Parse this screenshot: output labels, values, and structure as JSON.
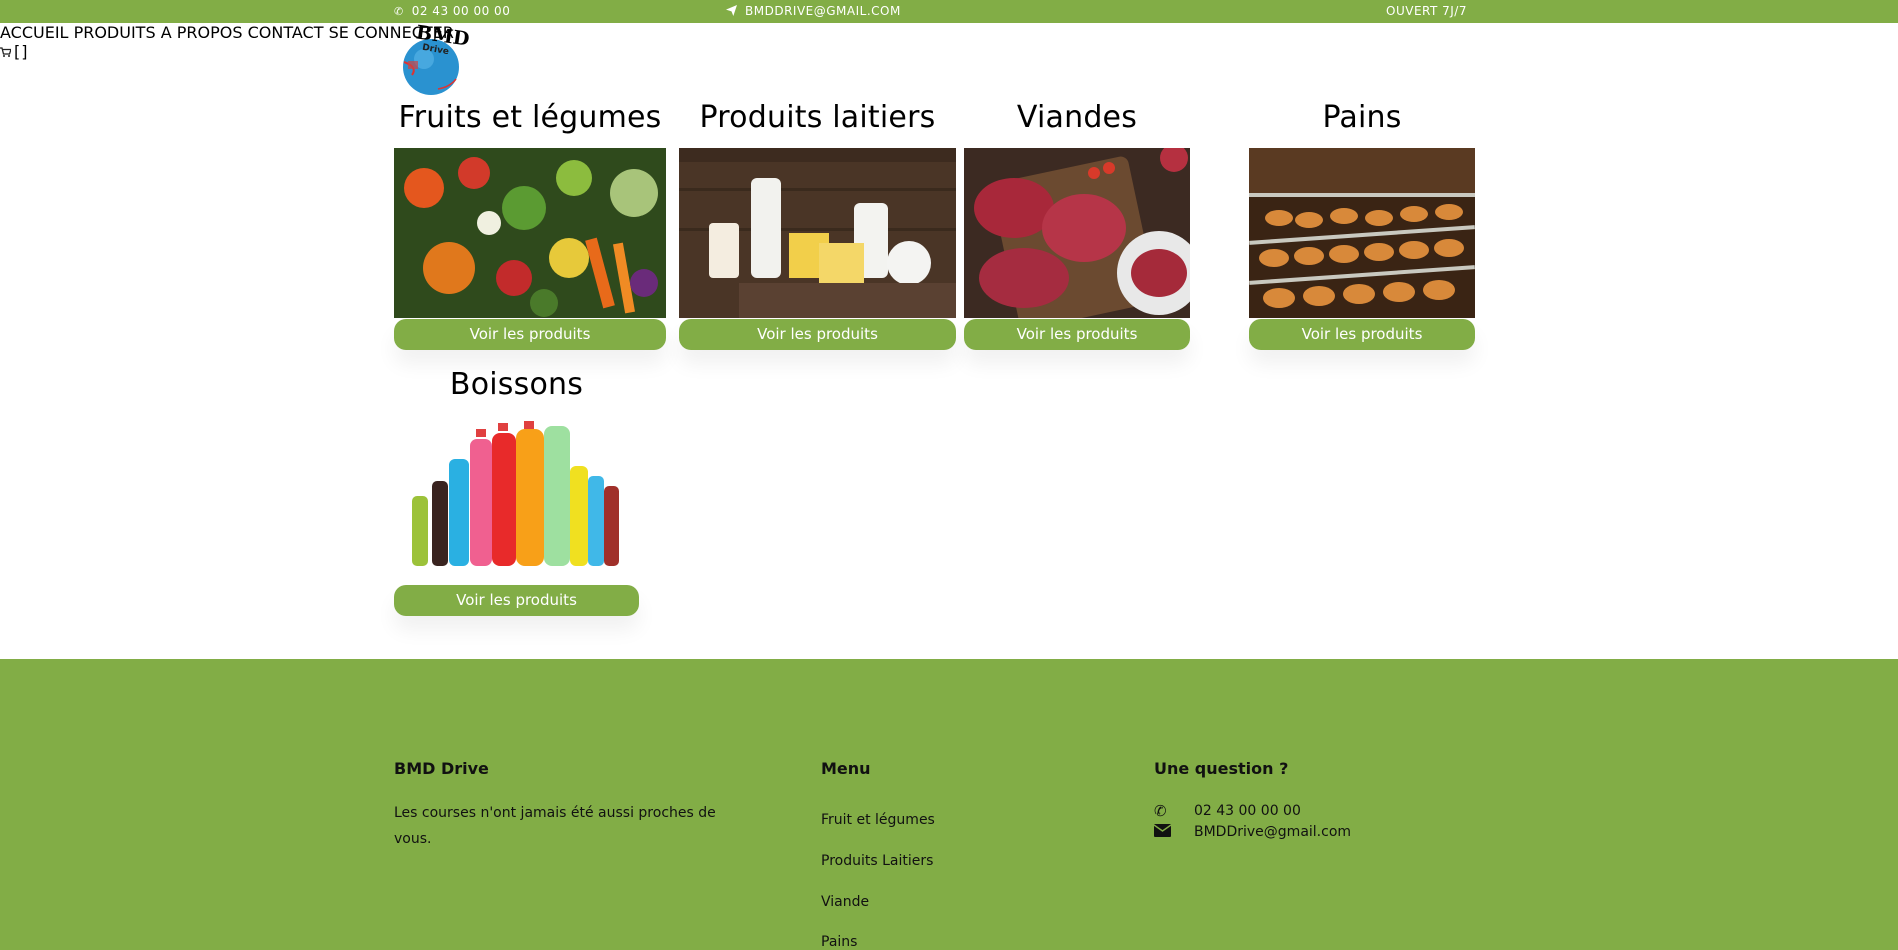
{
  "topbar": {
    "phone": "02 43 00 00 00",
    "email": "BMDDRIVE@GMAIL.COM",
    "hours": "OUVERT 7J/7"
  },
  "logo": {
    "text_top": "BMD",
    "text_bottom": "Drive"
  },
  "nav": {
    "items": [
      "ACCUEIL",
      "PRODUITS",
      "A PROPOS",
      "CONTACT",
      "SE CONNECTER"
    ],
    "cart": "[]"
  },
  "categories": [
    {
      "title": "Fruits et légumes",
      "button": "Voir les produits"
    },
    {
      "title": "Produits laitiers",
      "button": "Voir les produits"
    },
    {
      "title": "Viandes",
      "button": "Voir les produits"
    },
    {
      "title": "Pains",
      "button": "Voir les produits"
    },
    {
      "title": "Boissons",
      "button": "Voir les produits"
    }
  ],
  "footer": {
    "brand_title": "BMD Drive",
    "brand_text": "Les courses n'ont jamais été aussi proches de vous.",
    "menu_title": "Menu",
    "menu_items": [
      "Fruit et légumes",
      "Produits Laitiers",
      "Viande",
      "Pains"
    ],
    "question_title": "Une question ?",
    "phone": "02 43 00 00 00",
    "email": "BMDDrive@gmail.com"
  },
  "colors": {
    "brand_green": "#82ad46"
  }
}
